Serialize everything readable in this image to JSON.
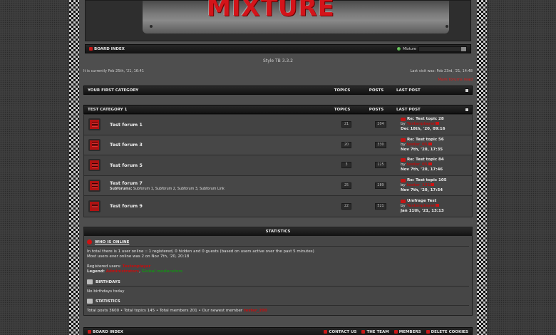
{
  "banner": {
    "logo_text": "MIXTURE"
  },
  "nav": {
    "board_index": "BOARD INDEX",
    "style_name": "Mixture"
  },
  "style_line": "Style TB 3.3.2",
  "meta": {
    "current_time": "It is currently Feb 25th, '21, 16:41",
    "last_visit": "Last visit was: Feb 23rd, '21, 14:48"
  },
  "mark_read": "Mark forums read",
  "categories": [
    {
      "title": "YOUR FIRST CATEGORY",
      "topics_label": "TOPICS",
      "posts_label": "POSTS",
      "last_label": "LAST POST"
    },
    {
      "title": "TEST CATEGORY 1",
      "topics_label": "TOPICS",
      "posts_label": "POSTS",
      "last_label": "LAST POST"
    }
  ],
  "forums": [
    {
      "name": "Test forum 1",
      "topics": "21",
      "posts": "204",
      "last_title": "Re: Test topic 28",
      "by": "by",
      "last_user": "Testenplayer",
      "last_date": "Dec 18th, '20, 09:16"
    },
    {
      "name": "Test forum 3",
      "topics": "20",
      "posts": "330",
      "last_title": "Re: Test topic 56",
      "by": "by",
      "last_user": "tester_05",
      "last_date": "Nov 7th, '20, 17:35"
    },
    {
      "name": "Test forum 5",
      "topics": "3",
      "posts": "125",
      "last_title": "Re: Test topic 84",
      "by": "by",
      "last_user": "tester_05",
      "last_date": "Nov 7th, '20, 17:46"
    },
    {
      "name": "Test forum 7",
      "topics": "25",
      "posts": "289",
      "last_title": "Re: Test topic 105",
      "by": "by",
      "last_user": "tester_131",
      "last_date": "Nov 7th, '20, 17:54",
      "subforums_label": "Subforums:",
      "subforums": "Subforum 1, Subforum 2, Subforum 3, Subforum Link"
    },
    {
      "name": "Test forum 9",
      "topics": "22",
      "posts": "521",
      "last_title": "Umfrage Test",
      "by": "by",
      "last_user": "Testenplayer",
      "last_date": "Jan 11th, '21, 13:13"
    }
  ],
  "stats": {
    "heading": "STATISTICS",
    "who_online_title": "WHO IS ONLINE",
    "online_line": "In total there is 1 user online :: 1 registered, 0 hidden and 0 guests (based on users active over the past 5 minutes)",
    "most_line": "Most users ever online was 2 on Nov 7th, '20, 20:18",
    "registered_label": "Registered users:",
    "registered_user": "Testenplayer",
    "legend_label": "Legend:",
    "legend_admin": "Administrators",
    "legend_sep": ",",
    "legend_mods": "Global moderators",
    "birthdays_title": "BIRTHDAYS",
    "birthdays_text": "No birthdays today",
    "statistics_title": "STATISTICS",
    "totals_text": "Total posts 3600 • Total topics 145 • Total members 201 • Our newest member",
    "newest_member": "tester_200"
  },
  "footer": {
    "board_index": "BOARD INDEX",
    "contact": "CONTACT US",
    "team": "THE TEAM",
    "members": "MEMBERS",
    "delete_cookies": "DELETE COOKIES"
  }
}
